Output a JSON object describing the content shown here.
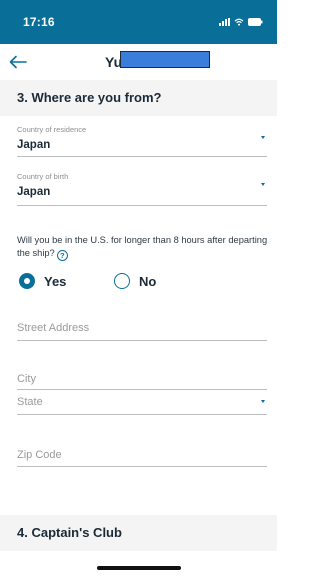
{
  "status": {
    "time": "17:16"
  },
  "nav": {
    "title": "Yu"
  },
  "section3": {
    "title": "3. Where are you from?"
  },
  "residence": {
    "label": "Country of residence",
    "value": "Japan"
  },
  "birth": {
    "label": "Country of birth",
    "value": "Japan"
  },
  "question": {
    "text": "Will you be in the U.S. for longer than 8 hours after departing the ship?",
    "help": "?"
  },
  "options": {
    "yes": "Yes",
    "no": "No",
    "selected": "Yes"
  },
  "street": {
    "placeholder": "Street Address"
  },
  "city": {
    "placeholder": "City"
  },
  "state": {
    "placeholder": "State"
  },
  "zip": {
    "placeholder": "Zip Code"
  },
  "section4": {
    "title": "4. Captain's Club"
  },
  "colors": {
    "brand": "#0a6f98",
    "redaction": "#3b7ddb"
  },
  "icons": [
    "back-arrow-icon",
    "signal-icon",
    "wifi-icon",
    "battery-icon",
    "help-icon",
    "dropdown-caret-icon"
  ]
}
